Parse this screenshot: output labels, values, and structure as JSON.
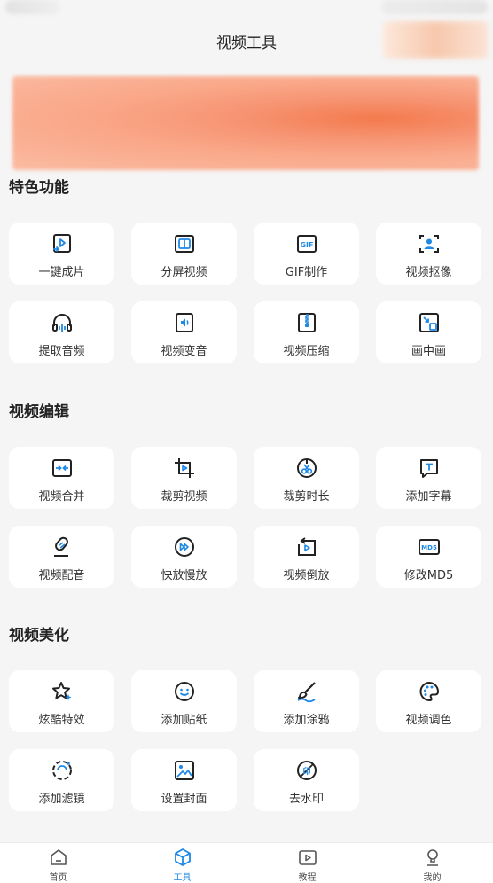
{
  "header": {
    "title": "视频工具"
  },
  "sections": [
    {
      "title": "特色功能",
      "items": [
        {
          "label": "一键成片",
          "icon": "one-click-video-icon"
        },
        {
          "label": "分屏视频",
          "icon": "split-screen-icon"
        },
        {
          "label": "GIF制作",
          "icon": "gif-icon"
        },
        {
          "label": "视频抠像",
          "icon": "portrait-cutout-icon"
        },
        {
          "label": "提取音频",
          "icon": "headphones-icon"
        },
        {
          "label": "视频变音",
          "icon": "voice-change-icon"
        },
        {
          "label": "视频压缩",
          "icon": "zip-icon"
        },
        {
          "label": "画中画",
          "icon": "picture-in-picture-icon"
        }
      ]
    },
    {
      "title": "视频编辑",
      "items": [
        {
          "label": "视频合并",
          "icon": "merge-icon"
        },
        {
          "label": "裁剪视频",
          "icon": "crop-icon"
        },
        {
          "label": "裁剪时长",
          "icon": "trim-duration-icon"
        },
        {
          "label": "添加字幕",
          "icon": "subtitle-icon"
        },
        {
          "label": "视频配音",
          "icon": "dubbing-icon"
        },
        {
          "label": "快放慢放",
          "icon": "speed-icon"
        },
        {
          "label": "视频倒放",
          "icon": "reverse-icon"
        },
        {
          "label": "修改MD5",
          "icon": "md5-icon"
        }
      ]
    },
    {
      "title": "视频美化",
      "items": [
        {
          "label": "炫酷特效",
          "icon": "sparkle-star-icon"
        },
        {
          "label": "添加贴纸",
          "icon": "sticker-icon"
        },
        {
          "label": "添加涂鸦",
          "icon": "brush-icon"
        },
        {
          "label": "视频调色",
          "icon": "palette-icon"
        },
        {
          "label": "添加滤镜",
          "icon": "filter-icon"
        },
        {
          "label": "设置封面",
          "icon": "cover-image-icon"
        },
        {
          "label": "去水印",
          "icon": "watermark-remove-icon"
        }
      ]
    }
  ],
  "tabbar": {
    "tabs": [
      {
        "label": "首页",
        "icon": "home-icon"
      },
      {
        "label": "工具",
        "icon": "tools-icon",
        "active": true
      },
      {
        "label": "教程",
        "icon": "tutorial-play-icon"
      },
      {
        "label": "我的",
        "icon": "profile-icon"
      }
    ]
  },
  "colors": {
    "icon": "#222222",
    "accent": "#1e88e5",
    "background": "#f5f5f5",
    "card": "#ffffff"
  }
}
